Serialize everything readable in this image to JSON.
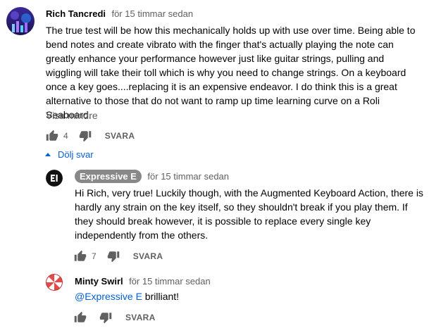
{
  "comment": {
    "author": "Rich Tancredi",
    "time": "för 15 timmar sedan",
    "text": "The true test will be how this mechanically holds up with use over time. Being able to bend notes and create vibrato with the finger that's actually playing the note can greatly enhance your performance however just like guitar strings, pulling and wiggling will take their toll which is why you need to change strings. On a keyboard once a key goes....replacing it is an expensive endeavor. I do think this is a great alternative to those that do not want to ramp up time learning curve on a Roli Seaboard.",
    "show_less": "Visa mindre",
    "likes": "4",
    "reply_label": "SVARA"
  },
  "hide_replies_label": "Dölj svar",
  "replies": [
    {
      "author": "Expressive E",
      "time": "för 15 timmar sedan",
      "text": "Hi Rich, very true! Luckily though, with the Augmented Keyboard Action, there is hardly any strain on the key itself, so they shouldn't break if you play them. If they should break however, it is possible to replace every single key independently from the others.",
      "likes": "7",
      "reply_label": "SVARA"
    },
    {
      "author": "Minty Swirl",
      "time": "för 15 timmar sedan",
      "mention": "@Expressive E",
      "text": " brilliant!",
      "reply_label": "SVARA"
    }
  ],
  "icons": {
    "like": "thumbs-up-icon",
    "dislike": "thumbs-down-icon",
    "hide": "caret-up-icon"
  }
}
